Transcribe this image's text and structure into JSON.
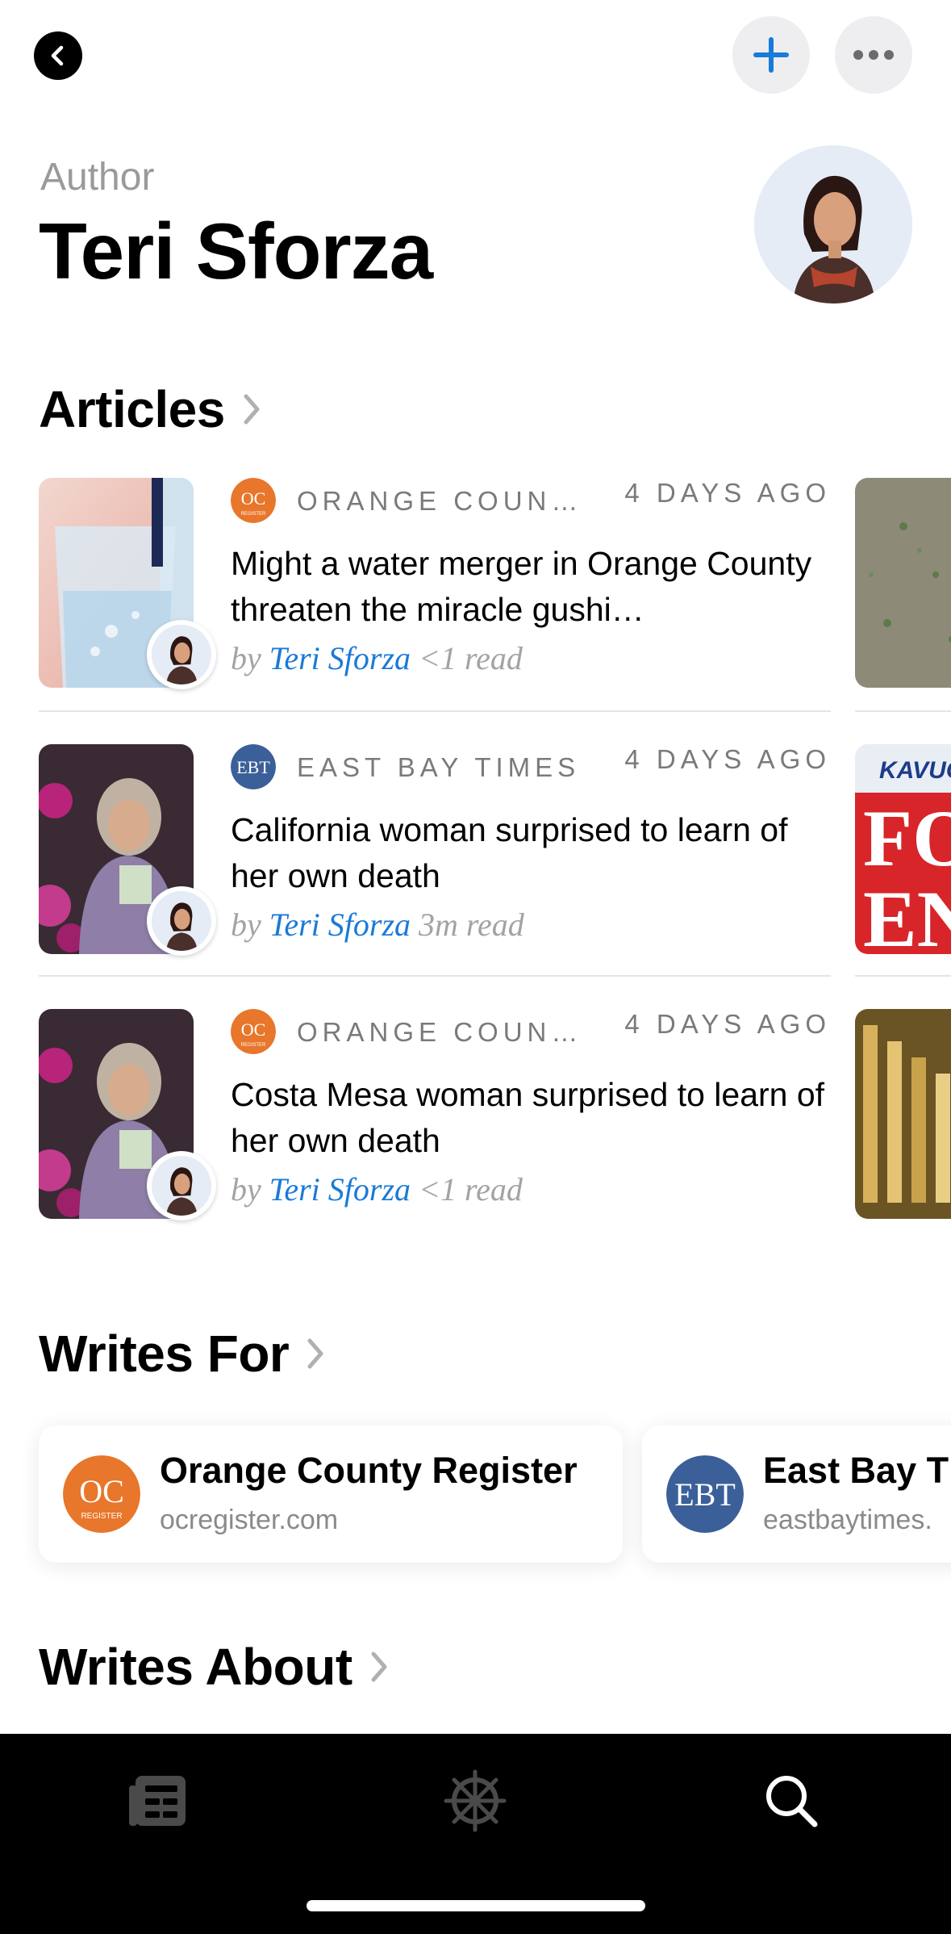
{
  "header": {
    "eyebrow": "Author",
    "title": "Teri Sforza"
  },
  "sections": {
    "articles": "Articles",
    "writes_for": "Writes For",
    "writes_about": "Writes About"
  },
  "articles": [
    {
      "publication": "ORANGE COUN…",
      "age": "4 DAYS AGO",
      "headline": "Might a water merger in Orange County threaten the miracle gushi…",
      "by": "by",
      "author": "Teri Sforza",
      "read": "<1 read"
    },
    {
      "publication": "EAST BAY TIMES",
      "age": "4 DAYS AGO",
      "headline": "California woman surprised to learn of her own death",
      "by": "by",
      "author": "Teri Sforza",
      "read": "3m read"
    },
    {
      "publication": "ORANGE COUN…",
      "age": "4 DAYS AGO",
      "headline": "Costa Mesa woman surprised to learn of her own death",
      "by": "by",
      "author": "Teri Sforza",
      "read": "<1 read"
    }
  ],
  "logos": {
    "oc": "OC",
    "oc_sub": "REGISTER",
    "ebt": "EBT"
  },
  "peek_text": {
    "sign_top": "KAVUON",
    "sign_mid": "FOR",
    "sign_bot": "EN"
  },
  "writes_for": [
    {
      "name": "Orange County Register",
      "domain": "ocregister.com"
    },
    {
      "name": "East Bay T",
      "domain": "eastbaytimes."
    }
  ],
  "tabbar": {
    "items": [
      "news-icon",
      "explore-icon",
      "search-icon"
    ]
  },
  "colors": {
    "accent": "#1a7ad8",
    "oc_orange": "#e8762b",
    "ebt_blue": "#3b5f99"
  }
}
